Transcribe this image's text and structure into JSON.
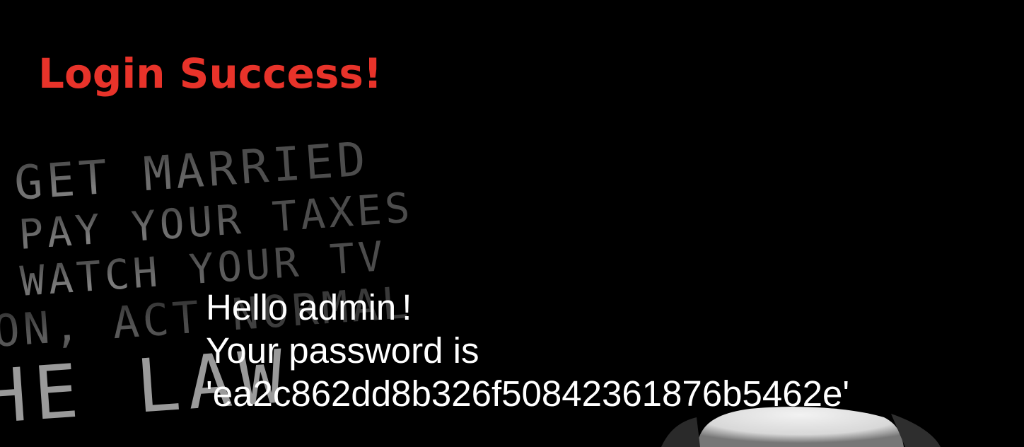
{
  "page": {
    "headline": "Login Success!",
    "greeting_name_line": "Hello admin",
    "greeting_bang": "!",
    "password_line": "Your password is",
    "password_value": "'ea2c862dd8b326f50842361876b5462e'"
  },
  "background_art": {
    "lines": [
      "GET MARRIED",
      "PAY YOUR TAXES",
      "WATCH YOUR TV",
      "ON, ACT NORMAL",
      "HE LAW"
    ]
  },
  "colors": {
    "background": "#000000",
    "headline": "#e8332a",
    "message_text": "#ffffff",
    "stencil_text": "#8a8a8a"
  }
}
